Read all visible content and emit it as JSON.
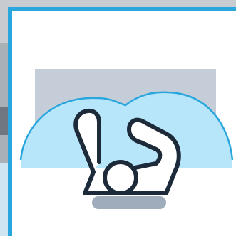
{
  "colors": {
    "frame": "#29a6dd",
    "card_background": "#ffffff",
    "backdrop_gray": "#9fa6ad",
    "gray_panel": "#c5ced8",
    "dome_fill": "#b7e6fa",
    "dome_stroke": "#29a6dd",
    "figure_stroke": "#1d2a3a",
    "shadow": "#9eacbc",
    "figure_fill": "#ffffff"
  },
  "icons": {
    "main": "person-reclining-in-tub-icon"
  }
}
